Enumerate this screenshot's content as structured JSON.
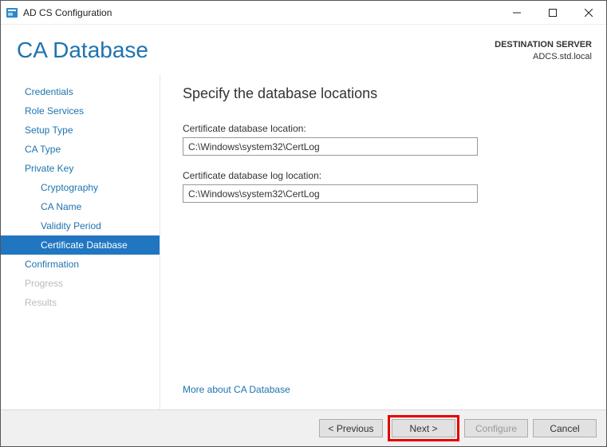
{
  "window": {
    "title": "AD CS Configuration"
  },
  "header": {
    "page_title": "CA Database",
    "dest_label": "DESTINATION SERVER",
    "dest_value": "ADCS.std.local"
  },
  "sidebar": {
    "items": [
      {
        "label": "Credentials",
        "type": "top",
        "state": "normal"
      },
      {
        "label": "Role Services",
        "type": "top",
        "state": "normal"
      },
      {
        "label": "Setup Type",
        "type": "top",
        "state": "normal"
      },
      {
        "label": "CA Type",
        "type": "top",
        "state": "normal"
      },
      {
        "label": "Private Key",
        "type": "top",
        "state": "normal"
      },
      {
        "label": "Cryptography",
        "type": "sub",
        "state": "normal"
      },
      {
        "label": "CA Name",
        "type": "sub",
        "state": "normal"
      },
      {
        "label": "Validity Period",
        "type": "sub",
        "state": "normal"
      },
      {
        "label": "Certificate Database",
        "type": "sub",
        "state": "selected"
      },
      {
        "label": "Confirmation",
        "type": "top",
        "state": "normal"
      },
      {
        "label": "Progress",
        "type": "top",
        "state": "disabled"
      },
      {
        "label": "Results",
        "type": "top",
        "state": "disabled"
      }
    ]
  },
  "main": {
    "heading": "Specify the database locations",
    "db_label": "Certificate database location:",
    "db_value": "C:\\Windows\\system32\\CertLog",
    "log_label": "Certificate database log location:",
    "log_value": "C:\\Windows\\system32\\CertLog",
    "more_link": "More about CA Database"
  },
  "footer": {
    "previous": "< Previous",
    "next": "Next >",
    "configure": "Configure",
    "cancel": "Cancel",
    "configure_enabled": false
  }
}
